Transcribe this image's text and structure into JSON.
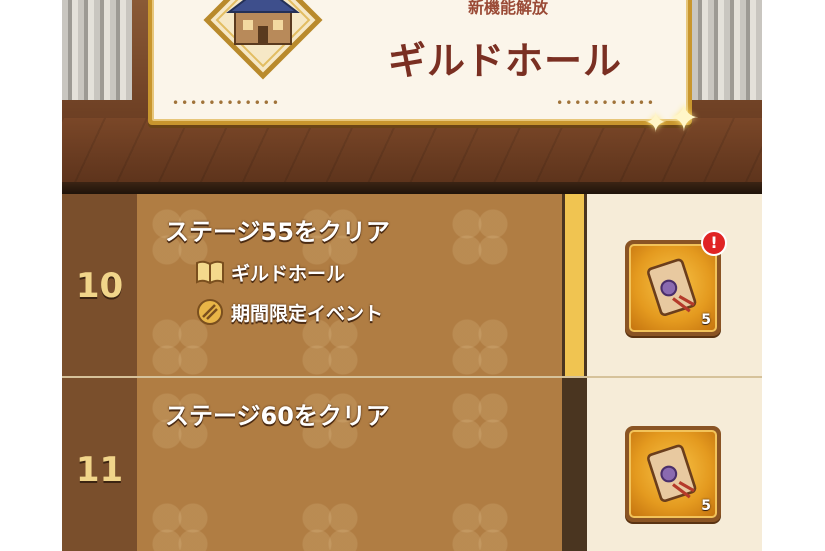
{
  "banner": {
    "subtitle": "新機能解放",
    "title": "ギルドホール",
    "dots_left": "••••••••••••",
    "dots_right": "•••••••••••"
  },
  "missions": [
    {
      "number": "10",
      "title": "ステージ55をクリア",
      "unlocks": [
        {
          "icon": "book-icon",
          "label": "ギルドホール"
        },
        {
          "icon": "event-emblem-icon",
          "label": "期間限定イベント"
        }
      ],
      "reward": {
        "icon": "scroll-icon",
        "quantity": "5"
      },
      "progress": 1.0,
      "notification": "!"
    },
    {
      "number": "11",
      "title": "ステージ60をクリア",
      "unlocks": [],
      "reward": {
        "icon": "scroll-icon",
        "quantity": "5"
      },
      "progress": 0.0,
      "notification": ""
    }
  ],
  "colors": {
    "progress_fill": "#f0c451",
    "mission_panel": "#b07d43",
    "number_column": "#7a4f2c",
    "reward_panel": "#f6ecd8",
    "badge": "#e02424"
  }
}
